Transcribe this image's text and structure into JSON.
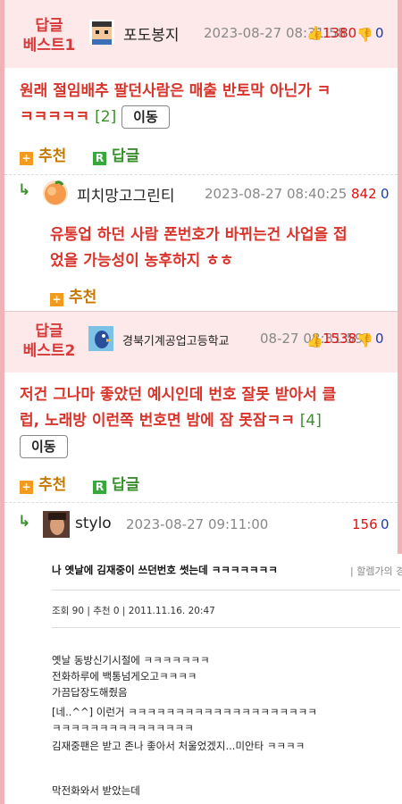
{
  "best1": {
    "tag": "답글\n베스트1",
    "tag_l1": "답글",
    "tag_l2": "베스트1",
    "nick": "포도봉지",
    "date": "2023-08-27 08:31:58",
    "up": "1380",
    "down": "0",
    "content": "원래 절임배추 팔던사람은 매출 반토막 아닌가 ㅋㅋㅋㅋㅋㅋ",
    "content_l1": "원래 절임배추 팔던사람은 매출 반토막 아닌가 ㅋ",
    "content_l2": "ㅋㅋㅋㅋㅋ",
    "reply_count": "[2]",
    "move_label": "이동",
    "recommend_label": "추천",
    "reply_label": "답글"
  },
  "reply1": {
    "nick": "피치망고그린티",
    "date": "2023-08-27 08:40:25",
    "up": "842",
    "down": "0",
    "content_l1": "유통업 하던 사람 폰번호가 바뀌는건 사업을 접",
    "content_l2": "었을 가능성이 농후하지 ㅎㅎ",
    "recommend_label": "추천"
  },
  "best2": {
    "tag_l1": "답글",
    "tag_l2": "베스트2",
    "nick": "경북기계공업고등학교",
    "date": "08-27 08:31:59",
    "up": "1538",
    "down": "0",
    "content_l1": "저건 그나마 좋았던 예시인데 번호 잘못 받아서 클",
    "content_l2": "럽, 노래방 이런쪽 번호면 밤에 잠 못잠ㅋㅋ",
    "reply_count": "[4]",
    "move_label": "이동",
    "recommend_label": "추천",
    "reply_label": "답글"
  },
  "reply2": {
    "nick": "stylo",
    "date": "2023-08-27 09:11:00",
    "up": "156",
    "down": "0"
  },
  "embed": {
    "title": "나 옛날에 김재중이 쓰던번호 썻는데 ㅋㅋㅋㅋㅋㅋㅋ",
    "sub": "| 할렘가의 경",
    "meta": "조회 90   |   추천 0   |   2011.11.16. 20:47",
    "body": [
      "옛날 동방신기시절에 ㅋㅋㅋㅋㅋㅋㅋ",
      "전화하루에 백통넘게오고ㅋㅋㅋㅋ",
      "가끔답장도해줬음",
      "[네..^^] 이런거 ㅋㅋㅋㅋㅋㅋㅋㅋㅋㅋㅋㅋㅋㅋㅋㅋㅋㅋㅋㅋ",
      "ㅋㅋㅋㅋㅋㅋㅋㅋㅋㅋㅋㅋㅋㅋㅋ",
      "김재중팬은 받고 존나 좋아서 처울었겠지...미안타 ㅋㅋㅋㅋ",
      "",
      "막전화와서 받았는데"
    ]
  },
  "colors": {
    "best_bg": "#fde9ea",
    "border": "#f0b2b7",
    "best_red": "#d8342c",
    "green": "#3a8f2c",
    "orange": "#f39b1e"
  }
}
